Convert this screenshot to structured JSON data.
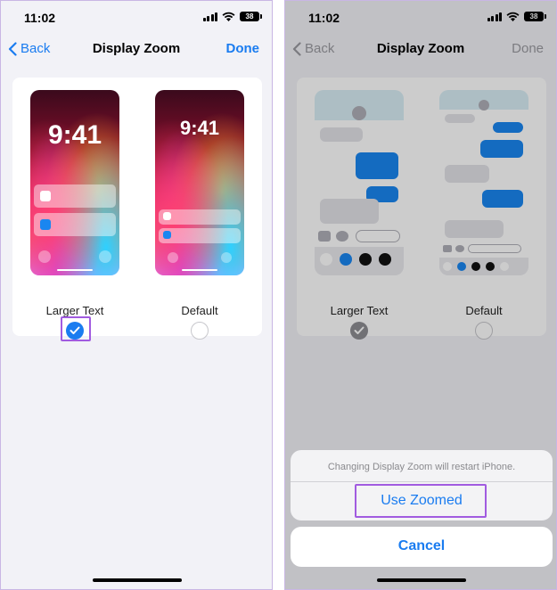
{
  "screens": [
    {
      "status": {
        "time": "11:02",
        "battery": "38"
      },
      "nav": {
        "back_label": "Back",
        "title": "Display Zoom",
        "done_label": "Done"
      },
      "options": [
        {
          "label": "Larger Text",
          "selected": true,
          "preview_time": "9:41"
        },
        {
          "label": "Default",
          "selected": false,
          "preview_time": "9:41"
        }
      ]
    },
    {
      "status": {
        "time": "11:02",
        "battery": "38"
      },
      "nav": {
        "back_label": "Back",
        "title": "Display Zoom",
        "done_label": "Done"
      },
      "options": [
        {
          "label": "Larger Text",
          "selected": true
        },
        {
          "label": "Default",
          "selected": false
        }
      ],
      "action_sheet": {
        "message": "Changing Display Zoom will restart iPhone.",
        "action_label": "Use Zoomed",
        "cancel_label": "Cancel"
      }
    }
  ],
  "colors": {
    "accent": "#1a7cf0",
    "highlight": "#a15be0",
    "background": "#f2f2f7"
  }
}
